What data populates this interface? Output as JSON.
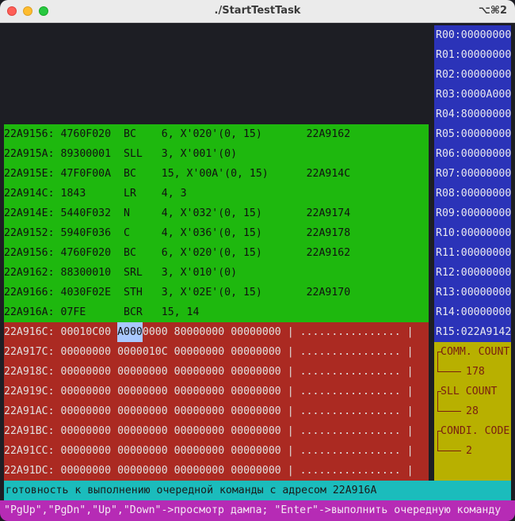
{
  "window": {
    "title": "./StartTestTask",
    "shortcut": "⌥⌘2"
  },
  "code_lines": [
    {
      "addr": "22A9156:",
      "hex": "4760F020",
      "op": "BC",
      "operands": "6, X'020'(0, 15)",
      "target": "22A9162"
    },
    {
      "addr": "22A915A:",
      "hex": "89300001",
      "op": "SLL",
      "operands": "3, X'001'(0)",
      "target": ""
    },
    {
      "addr": "22A915E:",
      "hex": "47F0F00A",
      "op": "BC",
      "operands": "15, X'00A'(0, 15)",
      "target": "22A914C"
    },
    {
      "addr": "22A914C:",
      "hex": "1843",
      "op": "LR",
      "operands": "4, 3",
      "target": ""
    },
    {
      "addr": "22A914E:",
      "hex": "5440F032",
      "op": "N",
      "operands": "4, X'032'(0, 15)",
      "target": "22A9174"
    },
    {
      "addr": "22A9152:",
      "hex": "5940F036",
      "op": "C",
      "operands": "4, X'036'(0, 15)",
      "target": "22A9178"
    },
    {
      "addr": "22A9156:",
      "hex": "4760F020",
      "op": "BC",
      "operands": "6, X'020'(0, 15)",
      "target": "22A9162"
    },
    {
      "addr": "22A9162:",
      "hex": "88300010",
      "op": "SRL",
      "operands": "3, X'010'(0)",
      "target": ""
    },
    {
      "addr": "22A9166:",
      "hex": "4030F02E",
      "op": "STH",
      "operands": "3, X'02E'(0, 15)",
      "target": "22A9170"
    },
    {
      "addr": "22A916A:",
      "hex": "07FE",
      "op": "BCR",
      "operands": "15, 14",
      "target": ""
    }
  ],
  "dump_lines": [
    {
      "addr": "22A916C:",
      "w1": "00010C00",
      "w2a": "A000",
      "w2b": "0000",
      "w3": "80000000",
      "w4": "00000000",
      "ascii": "| ................ |"
    },
    {
      "addr": "22A917C:",
      "w1": "00000000",
      "w2a": "0000",
      "w2b": "010C",
      "w3": "00000000",
      "w4": "00000000",
      "ascii": "| ................ |"
    },
    {
      "addr": "22A918C:",
      "w1": "00000000",
      "w2a": "0000",
      "w2b": "0000",
      "w3": "00000000",
      "w4": "00000000",
      "ascii": "| ................ |"
    },
    {
      "addr": "22A919C:",
      "w1": "00000000",
      "w2a": "0000",
      "w2b": "0000",
      "w3": "00000000",
      "w4": "00000000",
      "ascii": "| ................ |"
    },
    {
      "addr": "22A91AC:",
      "w1": "00000000",
      "w2a": "0000",
      "w2b": "0000",
      "w3": "00000000",
      "w4": "00000000",
      "ascii": "| ................ |"
    },
    {
      "addr": "22A91BC:",
      "w1": "00000000",
      "w2a": "0000",
      "w2b": "0000",
      "w3": "00000000",
      "w4": "00000000",
      "ascii": "| ................ |"
    },
    {
      "addr": "22A91CC:",
      "w1": "00000000",
      "w2a": "0000",
      "w2b": "0000",
      "w3": "00000000",
      "w4": "00000000",
      "ascii": "| ................ |"
    },
    {
      "addr": "22A91DC:",
      "w1": "00000000",
      "w2a": "0000",
      "w2b": "0000",
      "w3": "00000000",
      "w4": "00000000",
      "ascii": "| ................ |"
    }
  ],
  "registers": [
    "R00:00000000",
    "R01:00000000",
    "R02:00000000",
    "R03:0000A000",
    "R04:80000000",
    "R05:00000000",
    "R06:00000000",
    "R07:00000000",
    "R08:00000000",
    "R09:00000000",
    "R10:00000000",
    "R11:00000000",
    "R12:00000000",
    "R13:00000000",
    "R14:00000000",
    "R15:022A9142"
  ],
  "info": [
    {
      "label": "COMM. COUNT",
      "value": "178"
    },
    {
      "label": "SLL COUNT",
      "value": "28"
    },
    {
      "label": "CONDI. CODE",
      "value": "2"
    }
  ],
  "status": "готовность к выполнению очередной команды с адресом 22A916A",
  "help": "\"PgUp\",\"PgDn\",\"Up\",\"Down\"->просмотр дампа; \"Enter\"->выполнить очередную команду",
  "colors": {
    "code_bg": "#1eb80e",
    "dump_bg": "#ab2a22",
    "registers_bg": "#2b33b8",
    "info_bg": "#b8b000",
    "status_bg": "#1bbcbc",
    "help_bg": "#b62bb5",
    "highlight": "#a9c8ff"
  }
}
